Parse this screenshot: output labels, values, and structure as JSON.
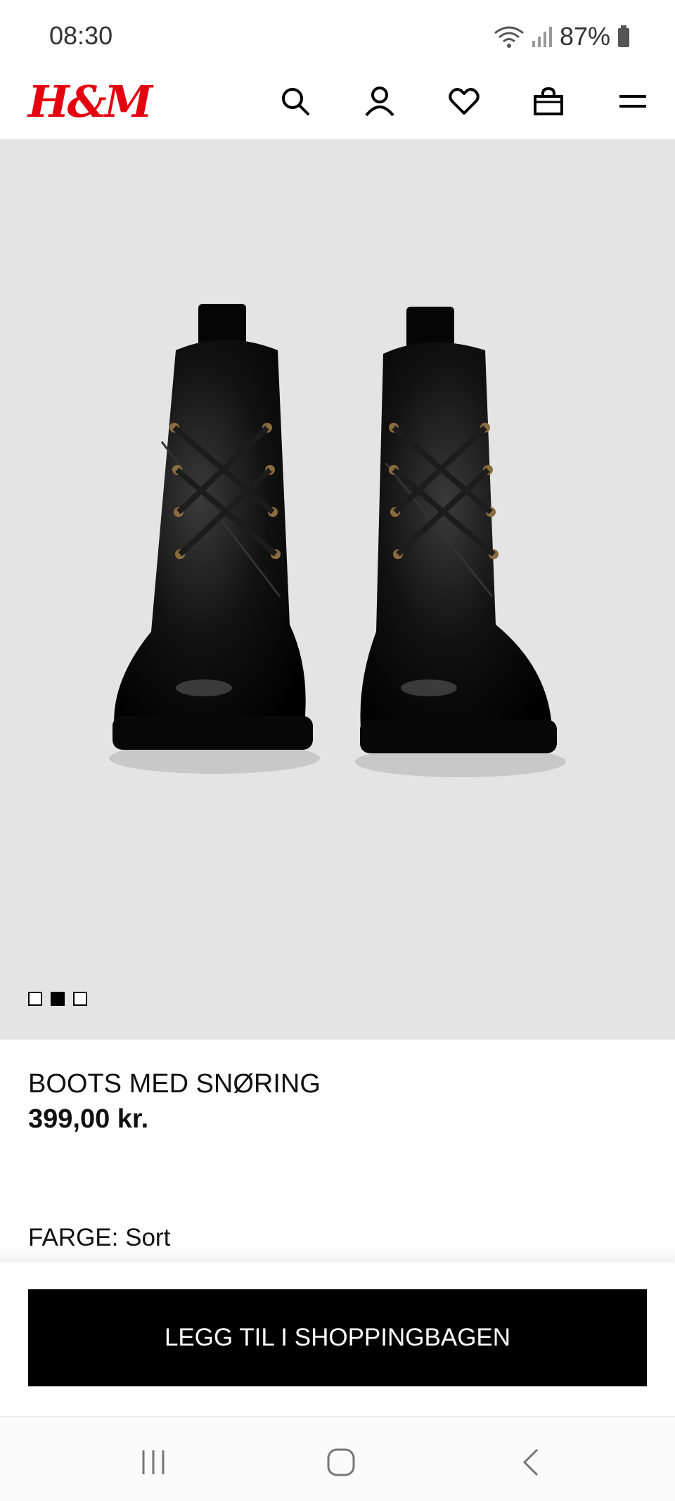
{
  "status": {
    "time": "08:30",
    "battery": "87%"
  },
  "header": {
    "logo": "H&M",
    "icons": [
      "search-icon",
      "account-icon",
      "heart-icon",
      "bag-icon",
      "menu-icon"
    ]
  },
  "product": {
    "title": "BOOTS MED SNØRING",
    "price": "399,00 kr.",
    "color_label": "FARGE:",
    "color_value": "Sort",
    "images": {
      "count": 3,
      "active_index": 2
    }
  },
  "cta": {
    "label": "LEGG TIL I SHOPPINGBAGEN"
  },
  "navbar": {
    "icons": [
      "recent-apps-icon",
      "home-icon",
      "back-icon"
    ]
  },
  "colors": {
    "brand": "#e50010",
    "cta_background": "#000000",
    "image_background": "#e4e4e4"
  }
}
